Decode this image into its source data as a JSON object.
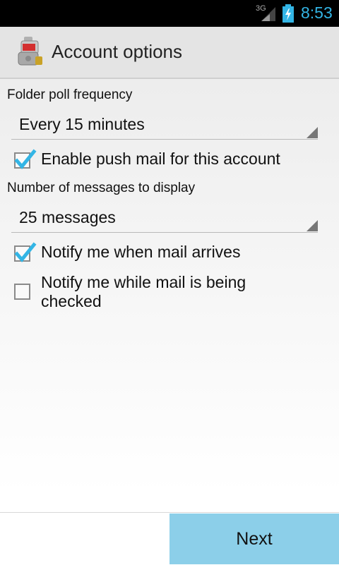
{
  "status_bar": {
    "network": "3G",
    "time": "8:53",
    "accent_color": "#33b5e5"
  },
  "header": {
    "title": "Account options",
    "icon": "mail-app-icon"
  },
  "poll": {
    "label": "Folder poll frequency",
    "selected": "Every 15 minutes"
  },
  "push": {
    "label": "Enable push mail for this account",
    "checked": true
  },
  "display": {
    "label": "Number of messages to display",
    "selected": "25 messages"
  },
  "notify_arrive": {
    "label": "Notify me when mail arrives",
    "checked": true
  },
  "notify_check": {
    "label": "Notify me while mail is being checked",
    "checked": false
  },
  "footer": {
    "next_label": "Next",
    "button_color": "#8ccfe9"
  }
}
